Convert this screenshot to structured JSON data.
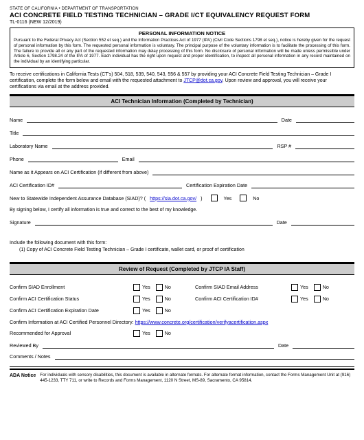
{
  "header": {
    "agency": "STATE OF CALIFORNIA • DEPARTMENT OF TRANSPORTATION",
    "title": "ACI CONCRETE FIELD TESTING TECHNICIAN – GRADE I/CT EQUIVALENCY REQUEST FORM",
    "form_number": "TL-0116 (NEW 12/2019)"
  },
  "notice": {
    "heading": "PERSONAL INFORMATION NOTICE",
    "text": "Pursuant to the Federal Privacy Act (Section 552 et seq.) and the Information Practices Act of 1977 (IPA) (Civil Code Sections 1798 et seq.), notice is hereby given for the request of personal information by this form. The requested personal information is voluntary. The principal purpose of the voluntary information is to facilitate the processing of this form. The failure to provide all or any part of the requested information may delay processing of this form. No disclosure of personal information will be made unless permissible under Article 6, Section 1798.24 of the IPA of 1977. Each individual has the right upon request and proper identification, to inspect all personal information in any record maintained on the individual by an identifying particular."
  },
  "intro": {
    "pre": "To receive certifications in California Tests (CT's) 504, 518, 539, 540, 543, 556 & 557 by providing your ACI Concrete Field Testing Technician – Grade I certification, complete the form below and email with the requested attachment to ",
    "email": "JTCP@dot.ca.gov",
    "post": ". Upon review and approval, you will receive your certifications via email at the address provided."
  },
  "section1": {
    "heading": "ACI Technician Information (Completed by Technician)",
    "name": "Name",
    "date": "Date",
    "title": "Title",
    "lab": "Laboratory Name",
    "rsp": "RSP #",
    "phone": "Phone",
    "email": "Email",
    "aciname": "Name as it Appears on ACI Certification (if different from above)",
    "aciid": "ACI Certification ID#",
    "certexp": "Certification Expiration Date",
    "siad_pre": "New to Statewide Independent Assurance Database (SIAD)? (",
    "siad_url": "https://sia.dot.ca.gov/",
    "siad_post": ")",
    "yes": "Yes",
    "no": "No",
    "affirm": "By signing below, I certify all information is true and correct to the best of my knowledge.",
    "signature": "Signature",
    "sig_date": "Date"
  },
  "include": {
    "line1": "Include the following document with this form:",
    "line2": "(1)  Copy of ACI Concrete Field Testing Technician – Grade I certificate, wallet card, or proof of certification"
  },
  "section2": {
    "heading": "Review of Request (Completed by JTCP IA Staff)",
    "r1a": "Confirm SIAD Enrollment",
    "r1b": "Confirm SIAD Email Address",
    "r2a": "Confirm ACI Certification Status",
    "r2b": "Confirm ACI Certification ID#",
    "r3a": "Confirm ACI Certification Expiration Date",
    "dir_pre": "Confirm Information at ACI Certified Personnel Directory: ",
    "dir_url": "https://www.concrete.org/certification/verifyacertification.aspx",
    "rec": "Recommended for Approval",
    "reviewed": "Reviewed By",
    "reviewed_date": "Date",
    "comments": "Comments / Notes",
    "yes": "Yes",
    "no": "No"
  },
  "footer": {
    "ada": "ADA Notice",
    "text": "For individuals with sensory disabilities, this document is available in alternate formats. For alternate format information, contact the Forms Management Unit at (916) 445-1233, TTY 711, or write to Records and Forms Management, 1120 N Street, MS-89, Sacramento, CA 95814."
  }
}
